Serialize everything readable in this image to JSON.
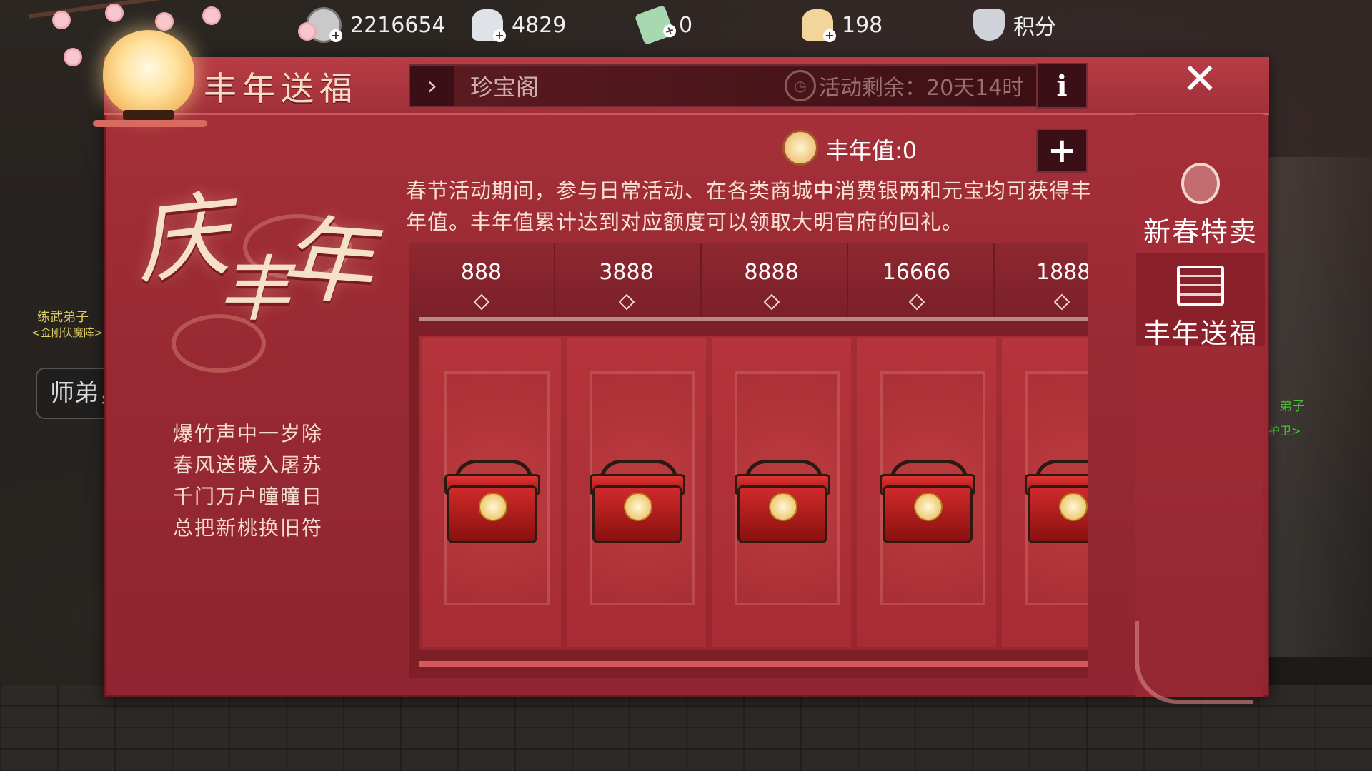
{
  "background": {
    "npc_chip": "师弟，",
    "npc_tags": [
      "练武弟子",
      "<金刚伏魔阵>",
      "弟子",
      "护卫>"
    ]
  },
  "topbar": {
    "currencies": [
      {
        "icon": "silver-coin-icon",
        "value": "2216654",
        "plus": "+"
      },
      {
        "icon": "silver-ingot-icon",
        "value": "4829",
        "plus": "+"
      },
      {
        "icon": "jade-ticket-icon",
        "value": "0",
        "plus": "+"
      },
      {
        "icon": "gold-ingot-icon",
        "value": "198",
        "plus": "+"
      }
    ],
    "points": {
      "icon": "shield-points-icon",
      "label": "积分"
    }
  },
  "header": {
    "title": "丰年送福",
    "nav_arrow": "›",
    "nav_label": "珍宝阁",
    "timer_text": "活动剩余：20天14时",
    "info_label": "i",
    "close_label": "✕"
  },
  "left_art": {
    "calligraphy": [
      "庆",
      "丰",
      "年"
    ],
    "poem": [
      "爆竹声中一岁除",
      "春风送暖入屠苏",
      "千门万户曈曈日",
      "总把新桃换旧符"
    ]
  },
  "value": {
    "icon": "lantern-coin-icon",
    "text": "丰年值:0",
    "plus_label": "+"
  },
  "description": "春节活动期间，参与日常活动、在各类商城中消费银两和元宝均可获得丰年值。丰年值累计达到对应额度可以领取大明官府的回礼。",
  "milestones": [
    {
      "threshold": "888",
      "reward_icon": "red-gift-box-icon"
    },
    {
      "threshold": "3888",
      "reward_icon": "red-gift-box-icon"
    },
    {
      "threshold": "8888",
      "reward_icon": "red-gift-box-icon"
    },
    {
      "threshold": "16666",
      "reward_icon": "red-gift-box-icon"
    },
    {
      "threshold": "1888",
      "reward_icon": "red-gift-box-icon"
    }
  ],
  "sidebar": {
    "items": [
      {
        "label": "新春特卖",
        "icon": "lantern-icon",
        "active": false
      },
      {
        "label": "丰年送福",
        "icon": "chest-icon",
        "active": true
      }
    ]
  },
  "colors": {
    "panel": "#a8313a",
    "header_dark": "#3a1016",
    "text_light": "#f7e0d4"
  }
}
